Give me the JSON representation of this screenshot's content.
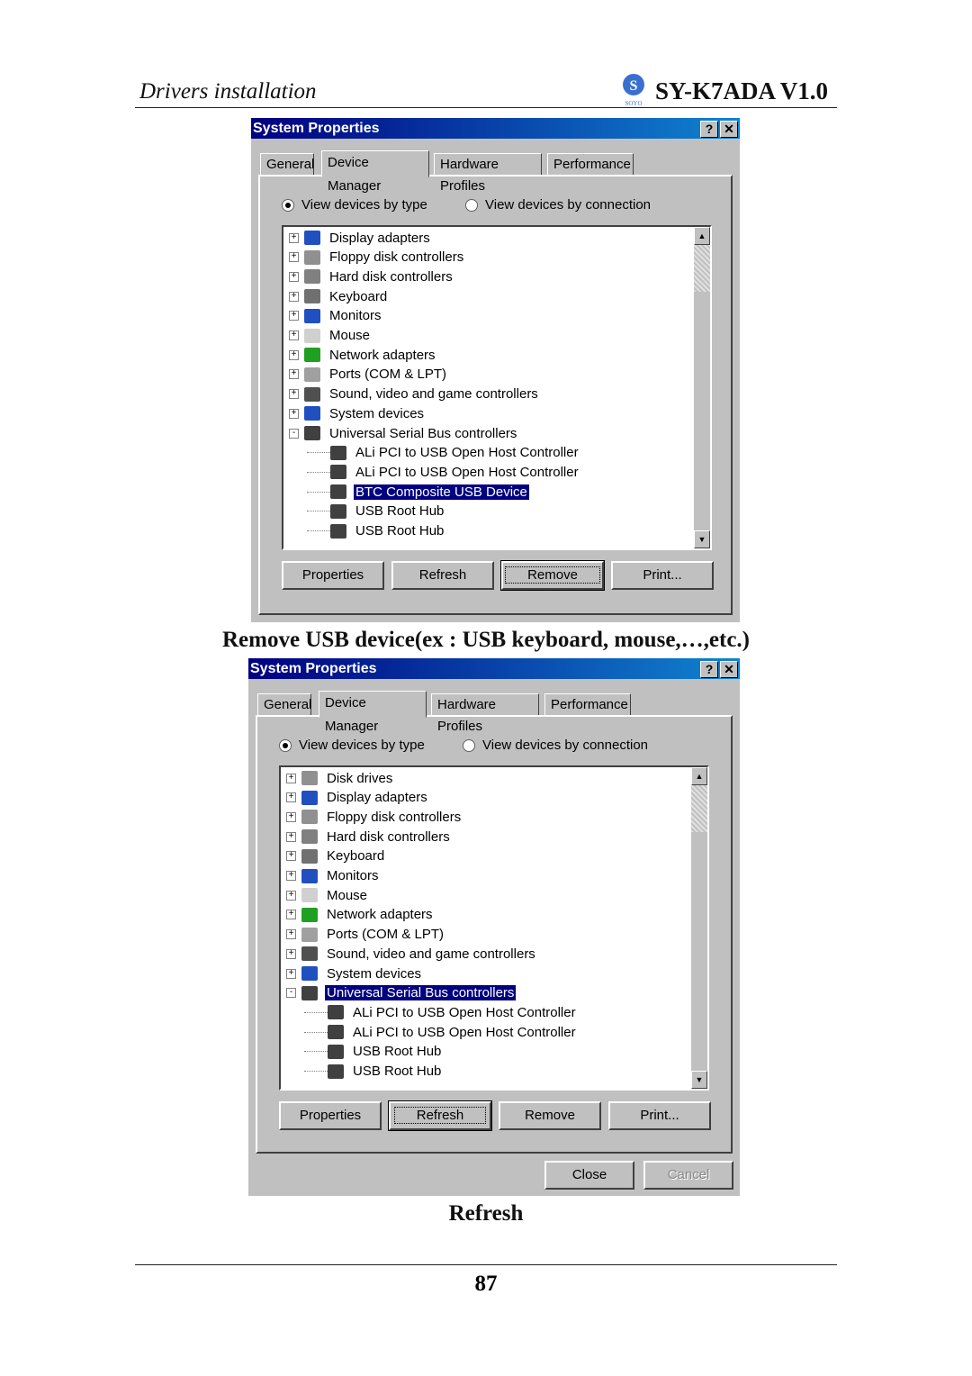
{
  "header": {
    "section": "Drivers installation",
    "model": "SY-K7ADA V1.0",
    "logo_text": "SOYO"
  },
  "dialog1": {
    "title": "System Properties",
    "help": "?",
    "close": "✕",
    "tabs": [
      "General",
      "Device Manager",
      "Hardware Profiles",
      "Performance"
    ],
    "active_tab": 1,
    "radio_type": "View devices by type",
    "radio_connection": "View devices by connection",
    "selected_radio": "type",
    "tree": [
      {
        "label": "Display adapters",
        "expander": "+",
        "icon": "display-icon",
        "level": 0
      },
      {
        "label": "Floppy disk controllers",
        "expander": "+",
        "icon": "floppy-icon",
        "level": 0
      },
      {
        "label": "Hard disk controllers",
        "expander": "+",
        "icon": "hard-disk-icon",
        "level": 0
      },
      {
        "label": "Keyboard",
        "expander": "+",
        "icon": "keyboard-icon",
        "level": 0
      },
      {
        "label": "Monitors",
        "expander": "+",
        "icon": "monitor-icon",
        "level": 0
      },
      {
        "label": "Mouse",
        "expander": "+",
        "icon": "mouse-icon",
        "level": 0
      },
      {
        "label": "Network adapters",
        "expander": "+",
        "icon": "network-icon",
        "level": 0
      },
      {
        "label": "Ports (COM & LPT)",
        "expander": "+",
        "icon": "port-icon",
        "level": 0
      },
      {
        "label": "Sound, video and game controllers",
        "expander": "+",
        "icon": "sound-icon",
        "level": 0
      },
      {
        "label": "System devices",
        "expander": "+",
        "icon": "system-icon",
        "level": 0
      },
      {
        "label": "Universal Serial Bus controllers",
        "expander": "-",
        "icon": "usb-icon",
        "level": 0
      },
      {
        "label": "ALi PCI to USB Open Host Controller",
        "icon": "usb-icon",
        "level": 1
      },
      {
        "label": "ALi PCI to USB Open Host Controller",
        "icon": "usb-icon",
        "level": 1
      },
      {
        "label": "BTC Composite USB Device",
        "icon": "usb-icon",
        "level": 1,
        "selected": true
      },
      {
        "label": "USB Root Hub",
        "icon": "usb-icon",
        "level": 1
      },
      {
        "label": "USB Root Hub",
        "icon": "usb-icon",
        "level": 1
      }
    ],
    "buttons": [
      "Properties",
      "Refresh",
      "Remove",
      "Print..."
    ],
    "default_button": "Remove"
  },
  "caption1": "Remove USB device(ex : USB keyboard, mouse,…,etc.)",
  "dialog2": {
    "title": "System Properties",
    "help": "?",
    "close": "✕",
    "tabs": [
      "General",
      "Device Manager",
      "Hardware Profiles",
      "Performance"
    ],
    "active_tab": 1,
    "radio_type": "View devices by type",
    "radio_connection": "View devices by connection",
    "selected_radio": "type",
    "tree": [
      {
        "label": "Disk drives",
        "expander": "+",
        "icon": "disk-drive-icon",
        "level": 0
      },
      {
        "label": "Display adapters",
        "expander": "+",
        "icon": "display-icon",
        "level": 0
      },
      {
        "label": "Floppy disk controllers",
        "expander": "+",
        "icon": "floppy-icon",
        "level": 0
      },
      {
        "label": "Hard disk controllers",
        "expander": "+",
        "icon": "hard-disk-icon",
        "level": 0
      },
      {
        "label": "Keyboard",
        "expander": "+",
        "icon": "keyboard-icon",
        "level": 0
      },
      {
        "label": "Monitors",
        "expander": "+",
        "icon": "monitor-icon",
        "level": 0
      },
      {
        "label": "Mouse",
        "expander": "+",
        "icon": "mouse-icon",
        "level": 0
      },
      {
        "label": "Network adapters",
        "expander": "+",
        "icon": "network-icon",
        "level": 0
      },
      {
        "label": "Ports (COM & LPT)",
        "expander": "+",
        "icon": "port-icon",
        "level": 0
      },
      {
        "label": "Sound, video and game controllers",
        "expander": "+",
        "icon": "sound-icon",
        "level": 0
      },
      {
        "label": "System devices",
        "expander": "+",
        "icon": "system-icon",
        "level": 0
      },
      {
        "label": "Universal Serial Bus controllers",
        "expander": "-",
        "icon": "usb-icon",
        "level": 0,
        "selected": true
      },
      {
        "label": "ALi PCI to USB Open Host Controller",
        "icon": "usb-icon",
        "level": 1
      },
      {
        "label": "ALi PCI to USB Open Host Controller",
        "icon": "usb-icon",
        "level": 1
      },
      {
        "label": "USB Root Hub",
        "icon": "usb-icon",
        "level": 1
      },
      {
        "label": "USB Root Hub",
        "icon": "usb-icon",
        "level": 1
      }
    ],
    "buttons": [
      "Properties",
      "Refresh",
      "Remove",
      "Print..."
    ],
    "default_button": "Refresh",
    "close_button": "Close",
    "cancel_button": "Cancel",
    "cancel_disabled": true
  },
  "caption2": "Refresh",
  "page_number": "87",
  "colors": {
    "titlebar": "#000080",
    "selection": "#000080",
    "dialog": "#c0c0c0"
  }
}
